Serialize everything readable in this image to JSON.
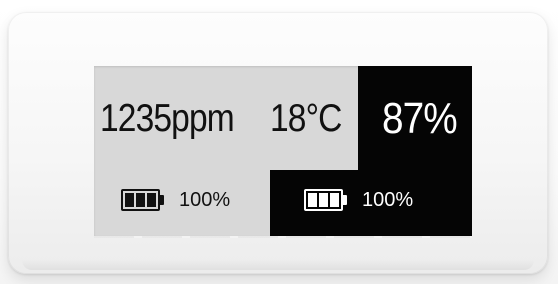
{
  "display": {
    "co2_text": "1235ppm",
    "temperature_text": "18°C",
    "humidity_text": "87%",
    "battery_left": {
      "icon": "battery-full-icon",
      "level_fraction": 1.0,
      "label": "100%"
    },
    "battery_right": {
      "icon": "battery-full-icon",
      "level_fraction": 1.0,
      "label": "100%"
    }
  },
  "colors": {
    "device_body": "#f6f6f6",
    "screen_background": "#d8d8d8",
    "inverted_block": "#050505",
    "ink_dark": "#111111",
    "ink_light": "#ffffff"
  }
}
